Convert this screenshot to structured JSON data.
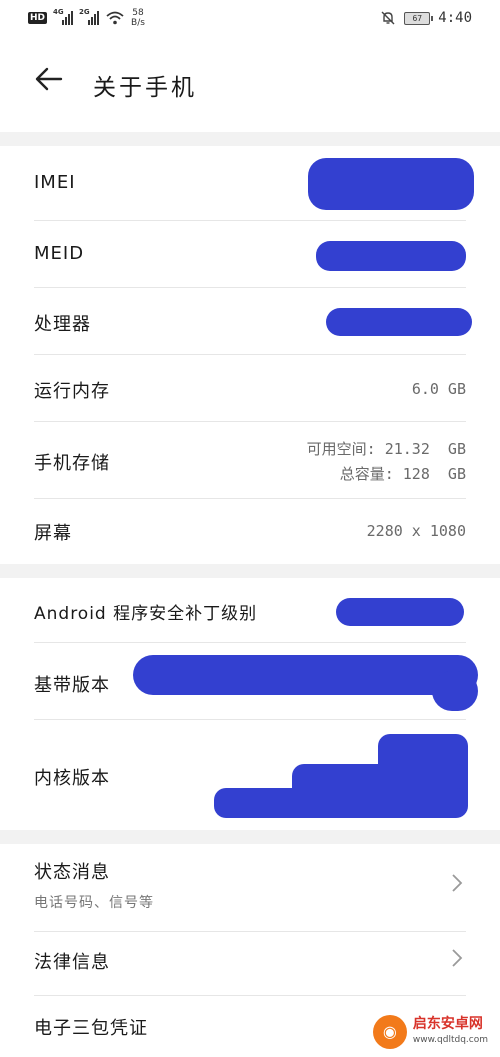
{
  "status_bar": {
    "hd": "HD",
    "sig1": "4G",
    "sig2": "2G",
    "speed_value": "58",
    "speed_unit": "B/s",
    "battery": "67",
    "time": "4:40"
  },
  "header": {
    "title": "关于手机"
  },
  "rows": {
    "imei": {
      "label": "IMEI"
    },
    "meid": {
      "label": "MEID"
    },
    "processor": {
      "label": "处理器"
    },
    "ram": {
      "label": "运行内存",
      "value": "6.0 GB"
    },
    "storage": {
      "label": "手机存储",
      "available": "可用空间: 21.32  GB",
      "total": "总容量: 128  GB"
    },
    "screen": {
      "label": "屏幕",
      "value": "2280 x 1080"
    },
    "android_patch": {
      "label": "Android 程序安全补丁级别"
    },
    "baseband": {
      "label": "基带版本"
    },
    "kernel": {
      "label": "内核版本"
    },
    "status": {
      "label": "状态消息",
      "sub": "电话号码、信号等"
    },
    "legal": {
      "label": "法律信息"
    },
    "warranty": {
      "label": "电子三包凭证"
    }
  },
  "watermark": {
    "text": "启东安卓网",
    "url": "www.qdltdq.com"
  },
  "colors": {
    "redaction": "#3340d0",
    "section_gap": "#f2f2f2"
  }
}
